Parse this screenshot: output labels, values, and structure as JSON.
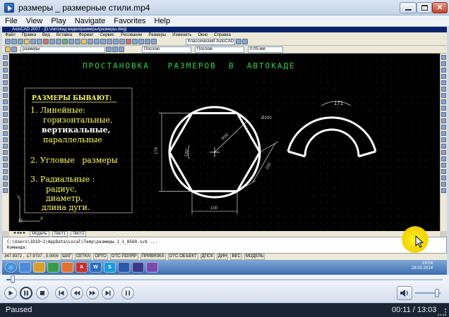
{
  "window": {
    "title": "размеры _ размерные стили.mp4"
  },
  "menu": [
    "File",
    "View",
    "Play",
    "Navigate",
    "Favorites",
    "Help"
  ],
  "acad": {
    "title": "AutoCAD 2007 - [D:\\Автокад видео\\размеры\\размеры.dwg]",
    "menu": [
      "Файл",
      "Правка",
      "Вид",
      "Вставка",
      "Формат",
      "Сервис",
      "Рисование",
      "Размеры",
      "Изменить",
      "Окно",
      "Справка"
    ],
    "workspace": "Классический AutoCAD",
    "layer": "размеры",
    "linetype1": "Послою",
    "linetype2": "Послою",
    "lineweight": "0.05 мм",
    "layout_tabs": [
      "Модель",
      "Лист1",
      "Лист2"
    ],
    "command_lines": [
      "C:\\Users\\1D1D~1\\AppData\\Local\\Temp\\размеры_1_1_8560.sv$ ...",
      "Команда:"
    ],
    "coords": "347.9372 , -17.9737 , 0.0000",
    "status_buttons": [
      "ШАГ",
      "СЕТКА",
      "ОРТО",
      "ОТС-ПОЛЯР",
      "ПРИВЯЗКА",
      "ОТС-ОБЪЕКТ",
      "ДПСК",
      "ДИН",
      "ВЕС",
      "МОДЕЛЬ"
    ],
    "tray_time": "19:04",
    "tray_date": "28.03.2014"
  },
  "drawing": {
    "heading": "ПРОСТАНОВКА   РАЗМЕРОВ  В  АВТОКАДЕ",
    "box_title": "РАЗМЕРЫ БЫВАЮТ:",
    "item1": "1. Линейные:",
    "item1_a": "горизонтальные,",
    "item1_b": "вертикальные,",
    "item1_c": "параллельные",
    "item2": "2. Угловые   размеры",
    "item3": "3. Радиальные :",
    "item3_a": "радиус,",
    "item3_b": "диаметр,",
    "item3_c": "длина дуги.",
    "dim_diam": "Ø100",
    "dim_174": "174",
    "dim_120": "120°",
    "dim_r50": "R50",
    "dim_100_right": "100",
    "dim_100_bottom": "100",
    "dim_arc": "171",
    "ucs_y": "Y",
    "ucs_x": "X"
  },
  "player": {
    "status": "Paused",
    "time": "00:11 / 13:03",
    "progress": 0.014,
    "volume": 0.85
  },
  "colors": {
    "accent": "#3b74c0",
    "heading": "#2fd04a",
    "text_yellow": "#ffff5a",
    "cad_bg": "#000000"
  }
}
